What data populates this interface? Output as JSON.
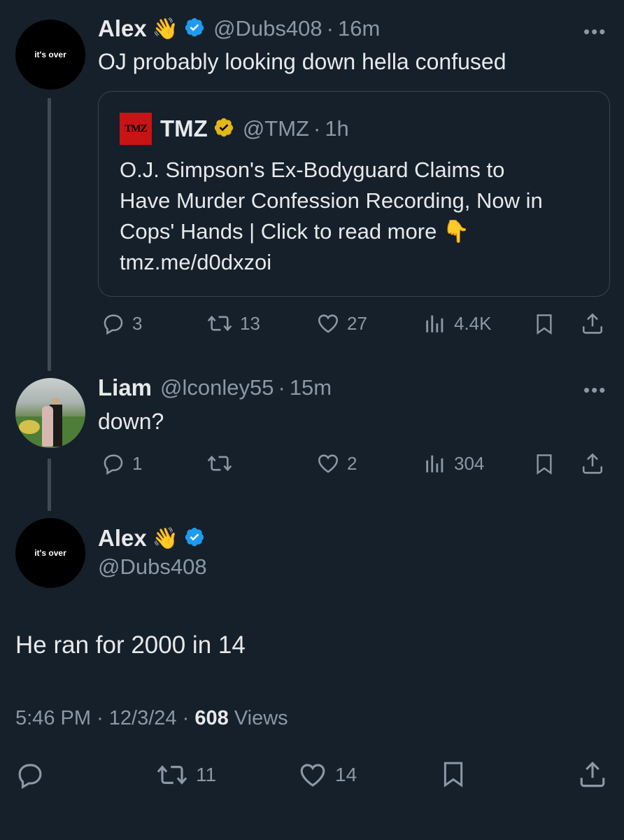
{
  "tweet1": {
    "avatar_text": "it's over",
    "name": "Alex",
    "emoji": "👋",
    "handle": "@Dubs408",
    "time": "16m",
    "more": "•••",
    "text": "OJ probably looking down hella confused",
    "quote": {
      "logo_text": "TMZ",
      "name": "TMZ",
      "handle": "@TMZ",
      "time": "1h",
      "text_line1": "O.J. Simpson's Ex-Bodyguard Claims to",
      "text_line2": "Have Murder Confession Recording, Now in",
      "text_line3": "Cops' Hands  | Click to read more 👇",
      "link": "tmz.me/d0dxzoi"
    },
    "replies": "3",
    "retweets": "13",
    "likes": "27",
    "views": "4.4K"
  },
  "tweet2": {
    "name": "Liam",
    "handle": "@lconley55",
    "time": "15m",
    "more": "•••",
    "text": "down?",
    "replies": "1",
    "retweets": "",
    "likes": "2",
    "views": "304"
  },
  "main": {
    "avatar_text": "it's over",
    "name": "Alex",
    "emoji": "👋",
    "handle": "@Dubs408",
    "text": "He ran for 2000 in 14",
    "time": "5:46 PM",
    "date": "12/3/24",
    "views_count": "608",
    "views_label": "Views",
    "retweets": "11",
    "likes": "14"
  },
  "separator": "·",
  "colors": {
    "background": "#15202b",
    "verified": "#1d9bf0",
    "gold": "#e2b719"
  }
}
